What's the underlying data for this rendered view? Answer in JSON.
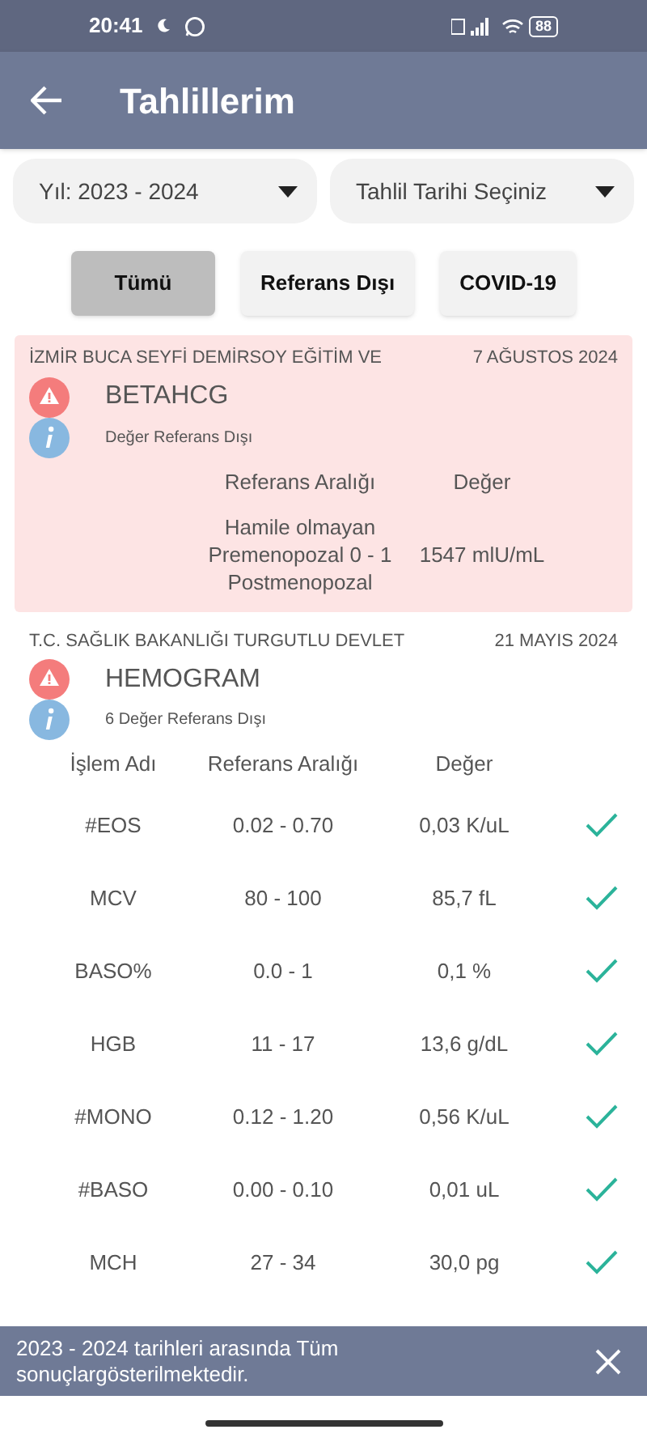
{
  "status_bar": {
    "time": "20:41",
    "battery": "88"
  },
  "app_bar": {
    "title": "Tahlillerim"
  },
  "dropdowns": [
    {
      "label": "Yıl: 2023 - 2024"
    },
    {
      "label": "Tahlil Tarihi Seçiniz"
    }
  ],
  "filters": [
    {
      "label": "Tümü",
      "selected": true
    },
    {
      "label": "Referans Dışı",
      "selected": false
    },
    {
      "label": "COVID-19",
      "selected": false
    }
  ],
  "results": [
    {
      "institution": "İZMİR BUCA SEYFİ DEMİRSOY EĞİTİM VE",
      "date": "7 AĞUSTOS 2024",
      "test": "BETAHCG",
      "note": "Değer Referans Dışı",
      "highlighted": true,
      "columns": [
        "Referans Aralığı",
        "Değer"
      ],
      "rows": [
        {
          "cells": [
            "Hamile olmayan Premenopozal  0 - 1 Postmenopozal",
            "1547 mlU/mL"
          ]
        }
      ]
    },
    {
      "institution": "T.C. SAĞLIK BAKANLIĞI TURGUTLU DEVLET",
      "date": "21 MAYIS 2024",
      "test": "HEMOGRAM",
      "note": "6 Değer Referans Dışı",
      "highlighted": false,
      "columns": [
        "İşlem Adı",
        "Referans Aralığı",
        "Değer"
      ],
      "rows": [
        {
          "cells": [
            "#EOS",
            "0.02 - 0.70",
            "0,03 K/uL"
          ],
          "checked": true
        },
        {
          "cells": [
            "MCV",
            "80 - 100",
            "85,7 fL"
          ],
          "checked": true
        },
        {
          "cells": [
            "BASO%",
            "0.0 - 1",
            "0,1 %"
          ],
          "checked": true
        },
        {
          "cells": [
            "HGB",
            "11 - 17",
            "13,6 g/dL"
          ],
          "checked": true
        },
        {
          "cells": [
            "#MONO",
            "0.12 - 1.20",
            "0,56 K/uL"
          ],
          "checked": true
        },
        {
          "cells": [
            "#BASO",
            "0.00 - 0.10",
            "0,01 uL"
          ],
          "checked": true
        },
        {
          "cells": [
            "MCH",
            "27 - 34",
            "30,0 pg"
          ],
          "checked": true
        }
      ]
    }
  ],
  "snackbar": {
    "message": "2023 - 2024 tarihleri arasında Tüm sonuçlargösterilmektedir."
  }
}
